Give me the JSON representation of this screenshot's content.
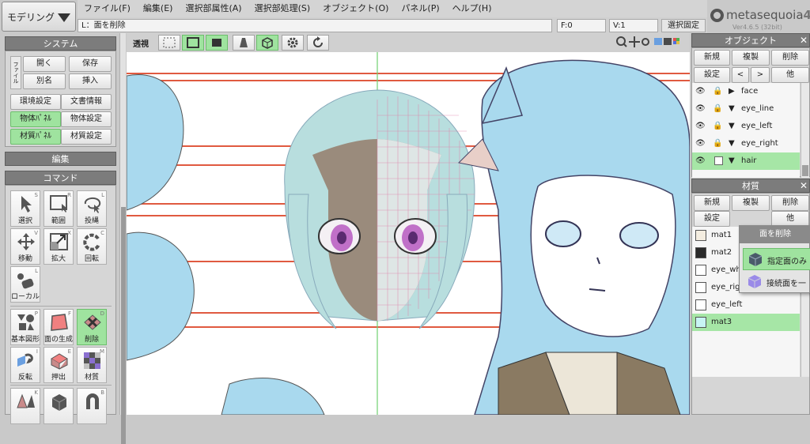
{
  "mode": {
    "label": "モデリング"
  },
  "menu": [
    "ファイル(F)",
    "編集(E)",
    "選択部属性(A)",
    "選択部処理(S)",
    "オブジェクト(O)",
    "パネル(P)",
    "ヘルプ(H)"
  ],
  "status": {
    "message": "L：面を削除",
    "f": "F:0",
    "v": "V:1",
    "button": "選択固定"
  },
  "logo": {
    "name": "metasequoia",
    "num": "4",
    "version": "Ver4.6.5 (32bit)"
  },
  "system_panel": {
    "title": "システム",
    "file_vert": "ファイル",
    "open": "開く",
    "save": "保存",
    "saveas": "別名",
    "insert": "挿入",
    "env": "環境設定",
    "docinfo": "文書情報",
    "obj_panel": "物体ﾊﾟﾈﾙ",
    "obj_settings": "物体設定",
    "mat_panel": "材質ﾊﾟﾈﾙ",
    "mat_settings": "材質設定"
  },
  "edit_panel": {
    "title": "編集"
  },
  "command_panel": {
    "title": "コマンド",
    "tools": [
      {
        "label": "選択",
        "key": "S"
      },
      {
        "label": "範囲",
        "key": "R"
      },
      {
        "label": "投縄",
        "key": "L"
      },
      {
        "label": "移動",
        "key": "V"
      },
      {
        "label": "拡大",
        "key": "X"
      },
      {
        "label": "回転",
        "key": "C"
      },
      {
        "label": "ローカル",
        "key": "L"
      }
    ],
    "tools2": [
      {
        "label": "基本図形",
        "key": "P"
      },
      {
        "label": "面の生成",
        "key": "F"
      },
      {
        "label": "削除",
        "key": "D"
      },
      {
        "label": "反転",
        "key": "I"
      },
      {
        "label": "押出",
        "key": "E"
      },
      {
        "label": "材質",
        "key": "M"
      }
    ],
    "tools3_keys": [
      "K",
      "",
      "B"
    ]
  },
  "viewport_toolbar": {
    "label": "透視"
  },
  "object_panel": {
    "title": "オブジェクト",
    "new": "新規",
    "copy": "複製",
    "delete": "削除",
    "settings": "設定",
    "up": "<",
    "down": ">",
    "other": "他",
    "items": [
      {
        "name": "face",
        "expanded": false,
        "selected": false
      },
      {
        "name": "eye_line",
        "expanded": true,
        "selected": false
      },
      {
        "name": "eye_left",
        "expanded": true,
        "selected": false
      },
      {
        "name": "eye_right",
        "expanded": true,
        "selected": false
      },
      {
        "name": "hair",
        "expanded": true,
        "selected": true
      }
    ]
  },
  "material_panel": {
    "title": "材質",
    "new": "新規",
    "copy": "複製",
    "delete": "削除",
    "settings": "設定",
    "other": "他",
    "items": [
      {
        "name": "mat1",
        "color": "#f4ede0"
      },
      {
        "name": "mat2",
        "color": "#2a2a2a"
      },
      {
        "name": "eye_wh",
        "color": "#ffffff"
      },
      {
        "name": "eye_rig",
        "color": "#ffffff"
      },
      {
        "name": "eye_left",
        "color": "#ffffff"
      },
      {
        "name": "mat3",
        "color": "#c8f4f4"
      }
    ]
  },
  "popup": {
    "title": "面を削除",
    "opt1": "指定面のみ",
    "opt2": "接続面を一"
  },
  "colors": {
    "accent_green": "#9fe39f",
    "panel_head": "#7c7c7c",
    "hair_blue": "#8ccdea"
  }
}
